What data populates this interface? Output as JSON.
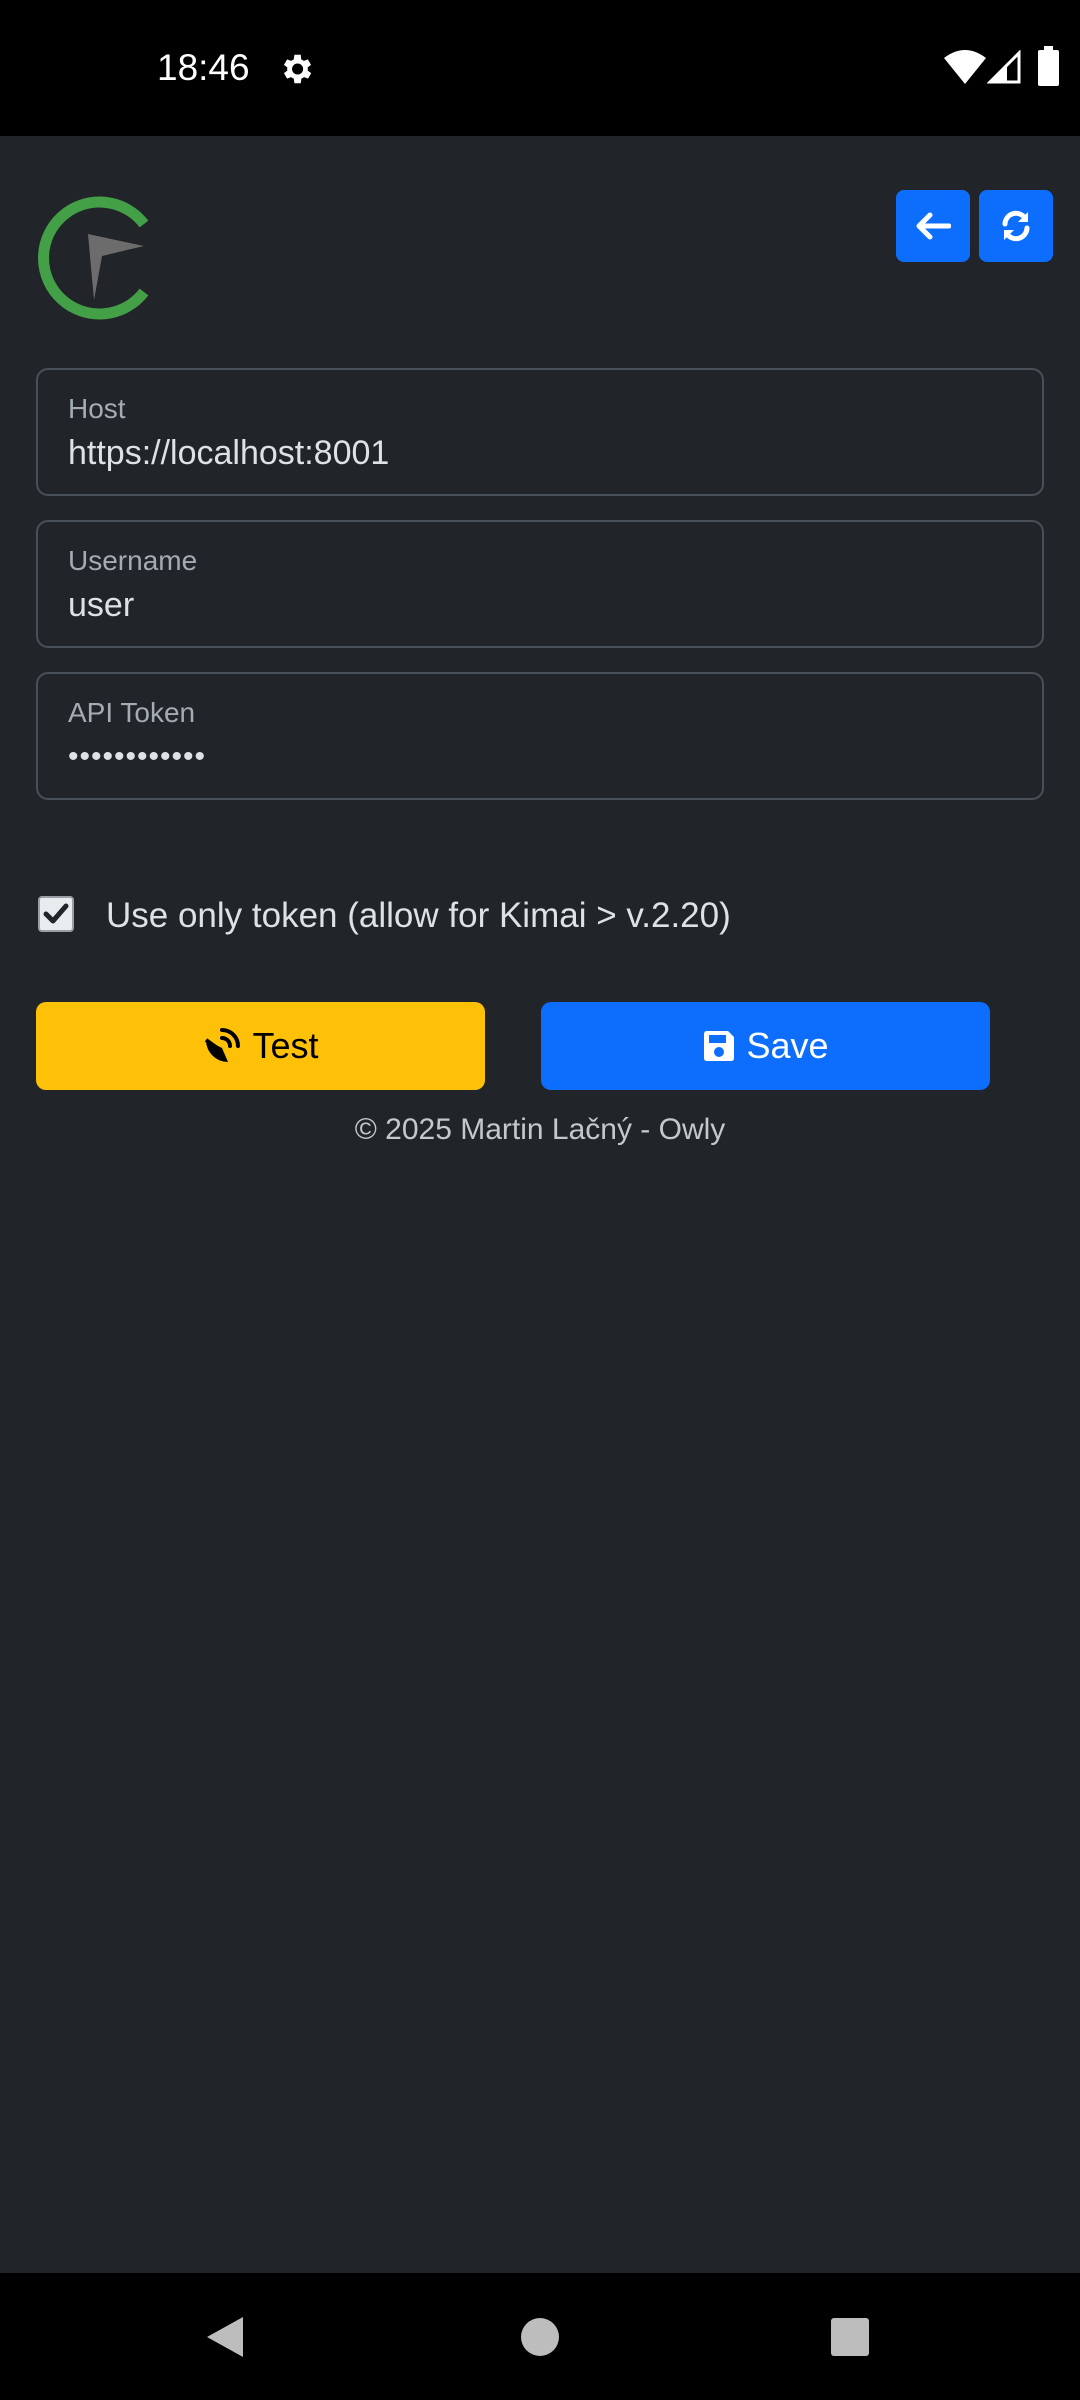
{
  "status_bar": {
    "time": "18:46",
    "icons": [
      "gear-icon",
      "wifi-icon",
      "signal-icon",
      "battery-icon"
    ]
  },
  "header": {
    "logo": "kimai-logo",
    "back_icon": "arrow-left-icon",
    "refresh_icon": "refresh-icon"
  },
  "form": {
    "host": {
      "label": "Host",
      "value": "https://localhost:8001"
    },
    "username": {
      "label": "Username",
      "value": "user"
    },
    "api_token": {
      "label": "API Token",
      "value": "••••••••••••"
    },
    "use_only_token": {
      "checked": true,
      "label": "Use only token (allow for Kimai > v.2.20)"
    }
  },
  "actions": {
    "test_label": "Test",
    "save_label": "Save"
  },
  "footer": {
    "text": "© 2025 Martin Lačný - Owly"
  },
  "colors": {
    "background": "#212529",
    "primary": "#0d6efd",
    "warning": "#ffc107",
    "logo_green": "#43a047"
  }
}
